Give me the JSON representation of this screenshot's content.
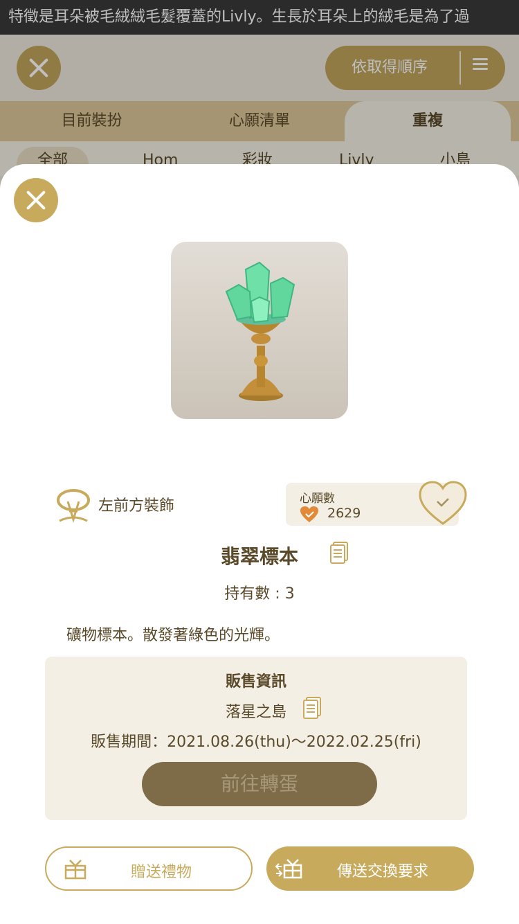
{
  "marquee": {
    "text": "：特徵是耳朵被毛絨絨毛髮覆蓋的Livly。生長於耳朵上的絨毛是為了過"
  },
  "background": {
    "sort_label": "依取得順序",
    "tabs": [
      "目前裝扮",
      "心願清單",
      "重複"
    ],
    "subtabs": [
      "全部",
      "Hom",
      "彩妝",
      "Livly",
      "小島"
    ]
  },
  "item": {
    "slot_label": "左前方裝飾",
    "wish_title": "心願數",
    "wish_count": "2629",
    "name": "翡翠標本",
    "owned": "持有數 : 3",
    "description": "礦物標本。散發著綠色的光輝。"
  },
  "sale": {
    "title": "販售資訊",
    "location": "落星之島",
    "period": "販售期間：2021.08.26(thu)〜2022.02.25(fri)",
    "gacha_button": "前往轉蛋"
  },
  "actions": {
    "gift_label": "贈送禮物",
    "trade_label": "傳送交換要求"
  },
  "colors": {
    "accent": "#c8aa5d",
    "panel": "#f4efe5",
    "text": "#5a4a2a",
    "disabled_button": "#7e6c49"
  }
}
